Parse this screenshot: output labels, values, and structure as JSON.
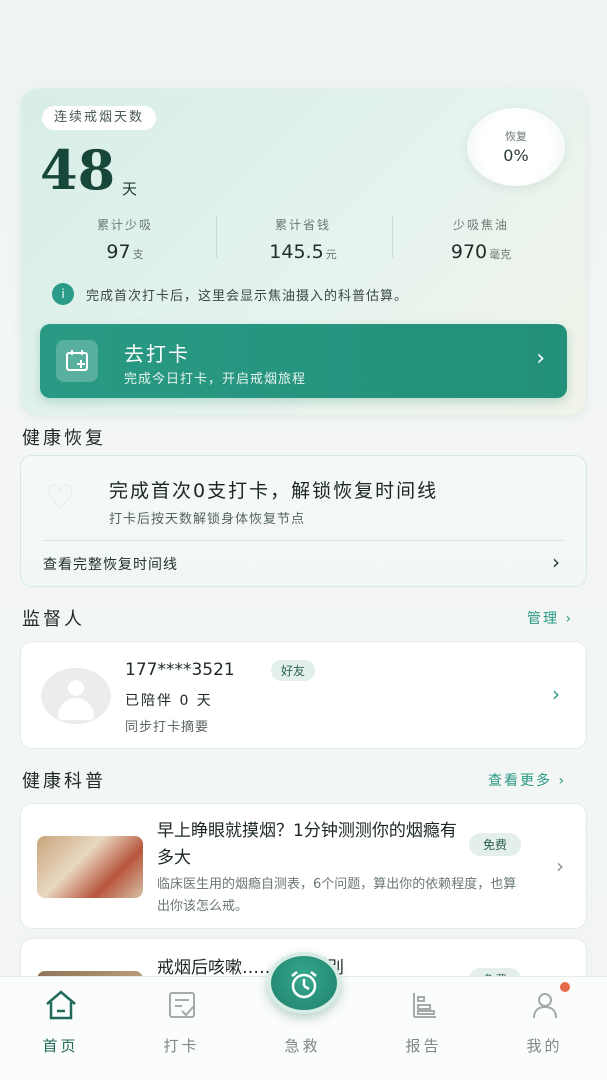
{
  "streak": {
    "label": "连续戒烟天数",
    "days": "48",
    "unit": "天",
    "recovery_label": "恢复",
    "recovery_value": "0%"
  },
  "stats": [
    {
      "label": "累计少吸",
      "value": "97",
      "unit": "支"
    },
    {
      "label": "累计省钱",
      "value": "145.5",
      "unit": "元"
    },
    {
      "label": "少吸焦油",
      "value": "970",
      "unit": "毫克"
    }
  ],
  "info": {
    "icon": "i",
    "text": "完成首次打卡后，这里会显示焦油摄入的科普估算。"
  },
  "checkin": {
    "title": "去打卡",
    "subtitle": "完成今日打卡，开启戒烟旅程",
    "chevron": "›",
    "icon": "calendar-plus-icon"
  },
  "health_recovery": {
    "section_title": "健康恢复",
    "title": "完成首次0支打卡，解锁恢复时间线",
    "subtitle": "打卡后按天数解锁身体恢复节点",
    "link": "查看完整恢复时间线",
    "chevron": "›"
  },
  "supervisor": {
    "section_title": "监督人",
    "manage": "管理 ›",
    "phone": "177****3521",
    "tag": "好友",
    "accompany": "已陪伴 0 天",
    "sync": "同步打卡摘要",
    "chevron": "›"
  },
  "science": {
    "section_title": "健康科普",
    "more": "查看更多 ›",
    "articles": [
      {
        "title": "早上睁眼就摸烟？1分钟测测你的烟瘾有多大",
        "tag": "免费",
        "desc": "临床医生用的烟瘾自测表，6个问题，算出你的依赖程度，也算出你该怎么戒。",
        "chevron": "›"
      },
      {
        "title": "戒烟后咳嗽……多了？别",
        "tag": "免费"
      }
    ]
  },
  "tabbar": {
    "items": [
      {
        "label": "首页",
        "icon": "home-icon"
      },
      {
        "label": "打卡",
        "icon": "checkin-icon"
      },
      {
        "label": "急救",
        "icon": "alarm-clock-icon"
      },
      {
        "label": "报告",
        "icon": "report-icon"
      },
      {
        "label": "我的",
        "icon": "profile-icon"
      }
    ],
    "active": "首页"
  },
  "colors": {
    "accent": "#2a9a84",
    "dark_green": "#17463b",
    "badge": "#e8684a"
  }
}
